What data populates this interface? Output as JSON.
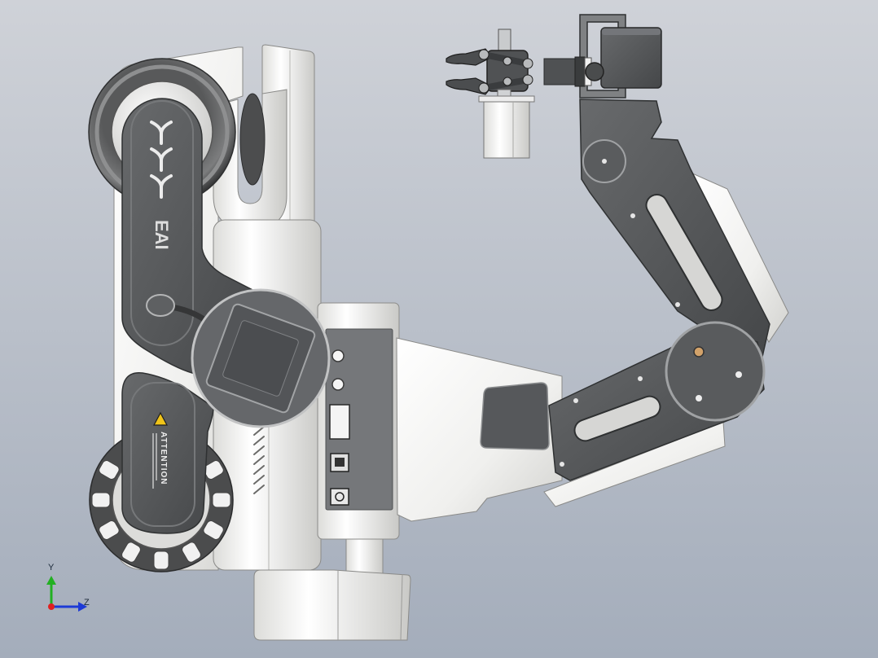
{
  "viewport": {
    "background_top": "#cfd2d8",
    "background_bottom": "#a4adbb"
  },
  "model": {
    "logo_text": "EAI",
    "warning_label": "ATTENTION",
    "colors": {
      "body_white": "#f4f4f2",
      "plate_dark": "#505253",
      "warning_yellow": "#f0c419",
      "pivot_orange": "#d2a26a"
    }
  },
  "triad": {
    "y_label": "Y",
    "z_label": "Z",
    "colors": {
      "x": "#e02020",
      "y": "#22b022",
      "z": "#1d3ad6"
    }
  }
}
